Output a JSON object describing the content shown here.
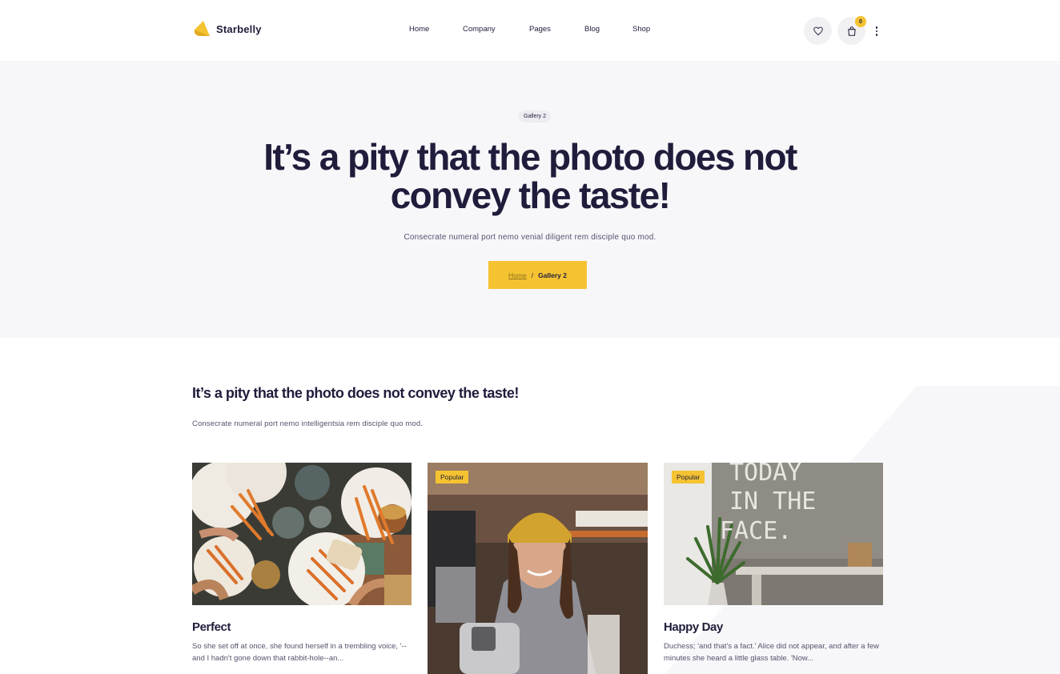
{
  "header": {
    "logo_text": "Starbelly",
    "nav": [
      "Home",
      "Company",
      "Pages",
      "Blog",
      "Shop"
    ],
    "cart_count": "0",
    "icons": [
      "heart-icon",
      "shopping-bag-icon",
      "more-vertical-icon"
    ],
    "accent_color": "#f5c332"
  },
  "banner": {
    "badge": "Gallery 2",
    "title": "It’s a pity that the photo does not convey the taste!",
    "subtitle": "Consecrate numeral port nemo venial diligent rem disciple quo mod.",
    "breadcrumb": {
      "home": "Home",
      "separator": "/",
      "current": "Gallery 2"
    }
  },
  "section": {
    "title": "It’s a pity that the photo does not convey the taste!",
    "subtitle": "Consecrate numeral port nemo intelligentsia rem disciple quo mod."
  },
  "cards": [
    {
      "badge": "",
      "title": "Perfect",
      "text": "So she set off at once, she found herself in a trembling voice, '--and I hadn't gone down that rabbit-hole--an..."
    },
    {
      "badge": "Popular",
      "title": "",
      "text": ""
    },
    {
      "badge": "Popular",
      "title": "Happy Day",
      "text": "Duchess; 'and that's a fact.' Alice did not appear, and after a few minutes she heard a little glass table. 'Now...",
      "wall_text": [
        "TODAY",
        "IN THE",
        "FACE."
      ]
    }
  ]
}
